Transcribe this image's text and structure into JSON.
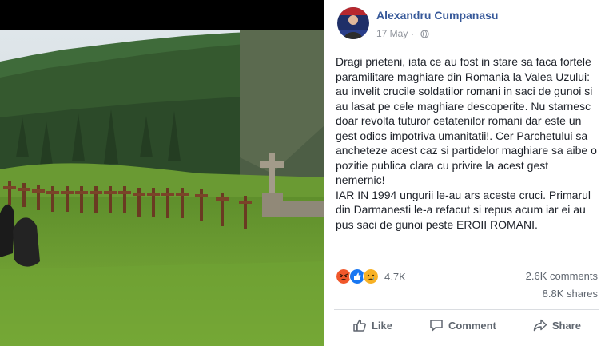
{
  "post": {
    "author": "Alexandru Cumpanasu",
    "date": "17 May",
    "separator": "·",
    "privacy_icon": "globe-icon",
    "paragraphs": [
      "Dragi prieteni, iata ce au fost in stare sa faca fortele paramilitare maghiare din Romania la Valea Uzului: au invelit crucile soldatilor romani in saci de gunoi si au lasat pe cele maghiare descoperite. Nu starnesc doar revolta tuturor cetatenilor romani dar este un gest odios impotriva umanitatii!. Cer Parchetului sa ancheteze acest caz si partidelor maghiare sa aibe o pozitie publica clara cu privire la acest gest nemernic!",
      "IAR IN 1994 ungurii le-au ars aceste cruci. Primarul din Darmanesti le-a refacut si repus acum iar ei au pus saci de gunoi peste EROII ROMANI."
    ]
  },
  "stats": {
    "reactions": [
      "angry",
      "like",
      "sad"
    ],
    "reaction_count": "4.7K",
    "comments": "2.6K comments",
    "shares": "8.8K shares"
  },
  "actions": {
    "like": "Like",
    "comment": "Comment",
    "share": "Share"
  },
  "colors": {
    "author_link": "#365899",
    "meta_gray": "#90949c",
    "text": "#1d2129",
    "like_blue": "#1877f2",
    "angry_orange": "#f0572a",
    "sad_yellow": "#f7b125"
  }
}
